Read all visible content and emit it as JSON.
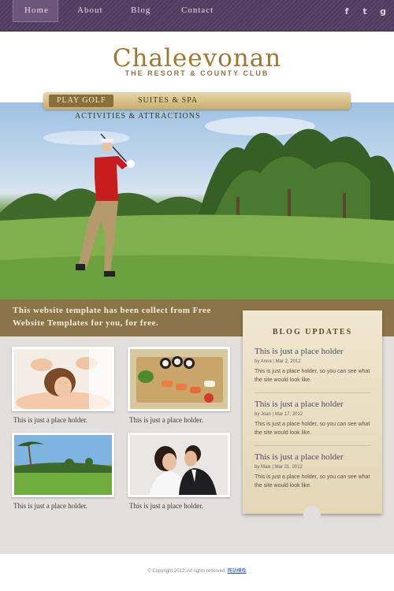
{
  "nav": {
    "items": [
      "Home",
      "About",
      "Blog",
      "Contact"
    ],
    "active": "Home"
  },
  "social": {
    "icons": [
      "facebook-icon",
      "twitter-icon",
      "google-plus-icon"
    ],
    "glyphs": [
      "f",
      "t",
      "g"
    ]
  },
  "logo": {
    "title": "Chaleevonan",
    "subtitle": "THE RESORT & COUNTY CLUB"
  },
  "submenu": {
    "items": [
      "PLAY GOLF",
      "SUITES & SPA",
      "ACTIVITIES & ATTRACTIONS"
    ],
    "active": "PLAY GOLF"
  },
  "banner": {
    "text": "This website template has been collect from Free Website Templates for you, for free."
  },
  "gallery": {
    "items": [
      {
        "image": "spa-massage",
        "caption": "This is just a place holder."
      },
      {
        "image": "sushi-platter",
        "caption": "This is just a place holder."
      },
      {
        "image": "golf-course",
        "caption": "This is just a place holder."
      },
      {
        "image": "wedding-couple",
        "caption": "This is just a place holder."
      }
    ]
  },
  "blog": {
    "title": "BLOG UPDATES",
    "posts": [
      {
        "title": "This is just a place holder",
        "meta": "by Anna | Mar 2, 2012",
        "body": "This is just a place holder, so you can see what the site would look like."
      },
      {
        "title": "This is just a place holder",
        "meta": "by Joan | Mar 17, 2012",
        "body": "This is just a place holder, so you can see what the site would look like."
      },
      {
        "title": "This is just a place holder",
        "meta": "by Maix | Mar 21, 2012",
        "body": "This is just a place holder, so you can see what the site would look like."
      }
    ]
  },
  "footer": {
    "copyright": "© Copyright 2012. All rights reserved.",
    "link": "网站模板"
  },
  "colors": {
    "nav_bg": "#4d3b5b",
    "gold": "#9d7a33",
    "banner": "#8a7448",
    "content_bg": "#e2dfdc"
  }
}
